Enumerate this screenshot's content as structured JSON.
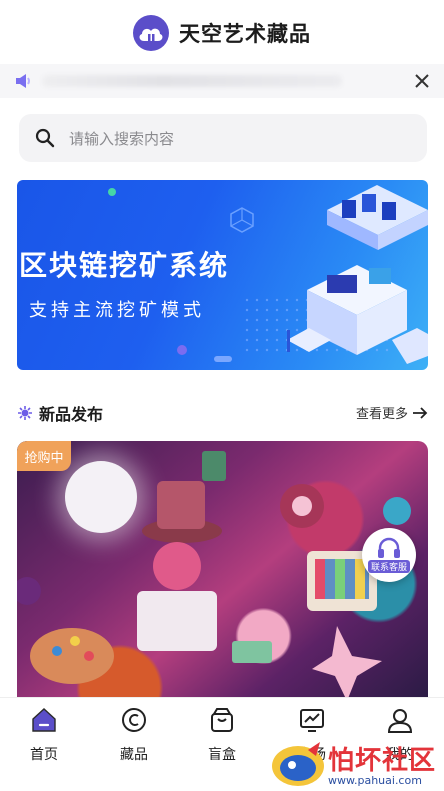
{
  "app": {
    "title": "天空艺术藏品",
    "accent": "#5b4ec9"
  },
  "notice": {
    "icon": "speaker-icon",
    "close_icon": "close-icon"
  },
  "search": {
    "placeholder": "请输入搜索内容",
    "icon": "search-icon"
  },
  "banner": {
    "title": "区块链挖矿系统",
    "subtitle": "支持主流挖矿模式",
    "accent": "#1e5fef"
  },
  "section": {
    "title": "新品发布",
    "more": "查看更多",
    "icon": "spark-icon"
  },
  "product": {
    "badge": "抢购中",
    "badge_color": "#f0a25a"
  },
  "service": {
    "label": "联系客服",
    "icon": "headphones-icon"
  },
  "tabs": [
    {
      "label": "首页",
      "icon": "home-icon",
      "active": true
    },
    {
      "label": "藏品",
      "icon": "copyright-icon"
    },
    {
      "label": "盲盒",
      "icon": "box-icon"
    },
    {
      "label": "市场",
      "icon": "chart-icon"
    },
    {
      "label": "我的",
      "icon": "user-icon"
    }
  ],
  "watermark": {
    "text": "怕坏社区",
    "url": "www.pahuai.com"
  }
}
